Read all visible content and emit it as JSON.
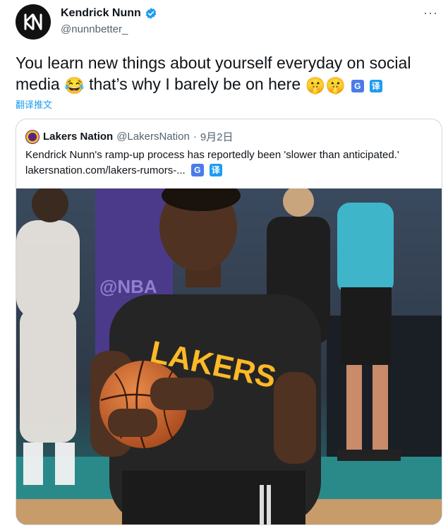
{
  "author": {
    "display_name": "Kendrick Nunn",
    "handle": "@nunnbetter_",
    "avatar_icon": "kn-logo-icon",
    "verified_icon": "verified-badge-icon"
  },
  "more_label": "···",
  "tweet": {
    "text_part1": "You learn new things about yourself everyday on social media ",
    "emoji_1": "😂",
    "text_part2": " that’s why I barely be on here ",
    "emoji_2": "🤫",
    "emoji_3": "🤫",
    "translate_icon_g": "G",
    "translate_icon_y": "译",
    "translate_link": "翻译推文"
  },
  "quote": {
    "display_name": "Lakers Nation",
    "handle": "@LakersNation",
    "separator": "·",
    "date": "9月2日",
    "text": "Kendrick Nunn's ramp-up process has reportedly been 'slower than anticipated.'",
    "link": "lakersnation.com/lakers-rumors-...",
    "translate_icon_g": "G",
    "translate_icon_y": "译",
    "photo_jersey_text": "LAKERS",
    "photo_banner_text": "@NBA"
  },
  "colors": {
    "accent": "#1d9bf0",
    "lakers_purple": "#552583",
    "lakers_gold": "#fdb927"
  }
}
